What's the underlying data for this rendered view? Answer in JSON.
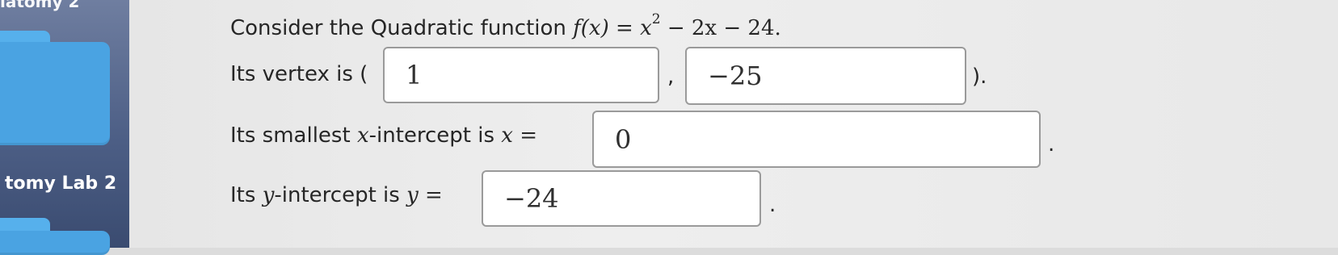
{
  "desktop": {
    "top_label": "iatomy 2",
    "folder_label": "tomy Lab 2"
  },
  "question": {
    "prompt_text": "Consider the Quadratic function ",
    "function_name": "f(x)",
    "equals": " = ",
    "var": "x",
    "exponent": "2",
    "rest": " − 2x − 24.",
    "vertex_label": "Its vertex is (",
    "vertex_x": "1",
    "comma": ",",
    "vertex_y": "−25",
    "close_paren": ").",
    "x_intercept_label_pre": "Its smallest ",
    "x_intercept_var": "x",
    "x_intercept_label_post": "-intercept is ",
    "x_intercept_eq": "x =",
    "x_intercept_value": "0",
    "period": ".",
    "y_intercept_label_pre": "Its ",
    "y_intercept_var": "y",
    "y_intercept_label_post": "-intercept is ",
    "y_intercept_eq": "y =",
    "y_intercept_value": "−24"
  }
}
